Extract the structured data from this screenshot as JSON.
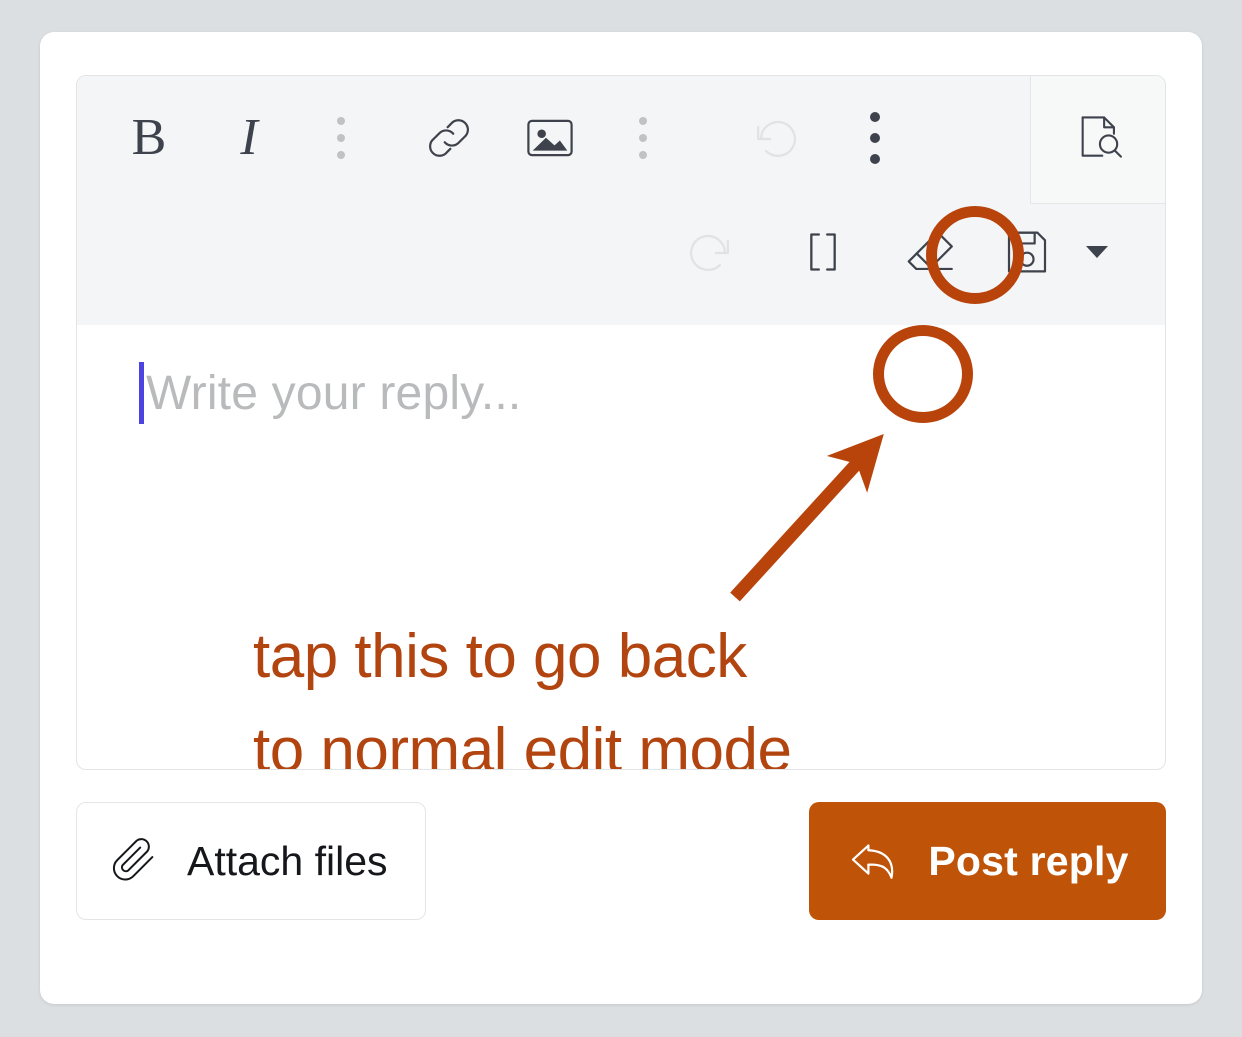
{
  "theme": {
    "page_background": "#dbdfe2",
    "card_background": "#ffffff",
    "toolbar_background": "#f4f5f6",
    "icon_color": "#3d424c",
    "icon_disabled_color": "#dfe1e3",
    "separator_dot_color": "#c0c2c5",
    "annotation_color": "#b24410",
    "highlight_ring_color": "#b8440c",
    "primary_button_color": "#bf5409",
    "caret_color": "#4b44e0",
    "placeholder_color": "#b9babb"
  },
  "editor": {
    "toolbar": {
      "row_1": [
        {
          "name": "bold-button",
          "label": "B",
          "kind": "letter",
          "state": "enabled"
        },
        {
          "name": "italic-button",
          "label": "I",
          "kind": "letter-italic",
          "state": "enabled"
        },
        {
          "name": "dots-separator-1",
          "label": "",
          "kind": "dots-separator",
          "state": "decorative"
        },
        {
          "name": "link-icon",
          "label": "",
          "kind": "icon",
          "state": "enabled"
        },
        {
          "name": "image-icon",
          "label": "",
          "kind": "icon",
          "state": "enabled"
        },
        {
          "name": "dots-separator-2",
          "label": "",
          "kind": "dots-separator",
          "state": "decorative"
        },
        {
          "name": "undo-icon",
          "label": "",
          "kind": "icon",
          "state": "disabled"
        },
        {
          "name": "overflow-menu-icon",
          "label": "",
          "kind": "dots-dark",
          "state": "highlighted"
        }
      ],
      "row_2": [
        {
          "name": "redo-icon",
          "label": "",
          "kind": "icon",
          "state": "disabled"
        },
        {
          "name": "source-code-brackets-icon",
          "label": "",
          "kind": "icon",
          "state": "highlighted"
        },
        {
          "name": "eraser-icon",
          "label": "",
          "kind": "icon",
          "state": "enabled"
        },
        {
          "name": "save-draft-icon",
          "label": "",
          "kind": "icon",
          "state": "enabled"
        },
        {
          "name": "save-dropdown-caret-icon",
          "label": "",
          "kind": "caret",
          "state": "enabled"
        }
      ],
      "preview_panel": {
        "name": "preview-document-icon",
        "label": "",
        "state": "enabled"
      }
    },
    "reply_field": {
      "placeholder": "Write your reply...",
      "value": "",
      "caret_visible": true
    }
  },
  "annotation": {
    "text": "tap this to go back\nto normal edit mode",
    "arrow": "arrow-up-right",
    "highlights": [
      {
        "name": "ring-overflow-menu",
        "targets": "overflow-menu-icon"
      },
      {
        "name": "ring-bracket-toggle",
        "targets": "source-code-brackets-icon"
      }
    ]
  },
  "footer": {
    "attach_files_label": "Attach files",
    "attach_files_icon": "paperclip-icon",
    "post_reply_label": "Post reply",
    "post_reply_icon": "reply-arrow-icon"
  }
}
